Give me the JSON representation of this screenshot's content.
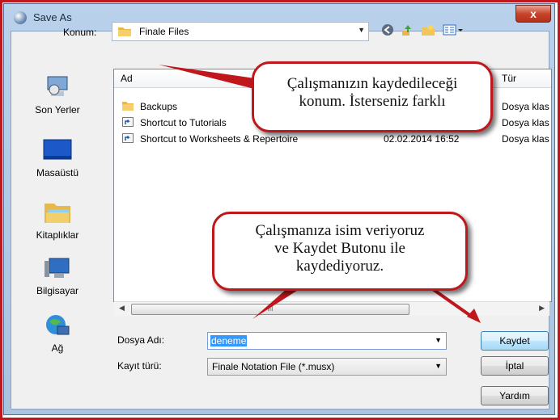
{
  "window": {
    "title": "Save As",
    "close_label": "x"
  },
  "location": {
    "label": "Konum:",
    "value": "Finale Files"
  },
  "toolbar": {
    "icons": [
      "back-icon",
      "up-folder-icon",
      "new-folder-icon",
      "view-menu-icon"
    ]
  },
  "places": [
    {
      "label": "Son Yerler",
      "icon": "recent-places-icon"
    },
    {
      "label": "Masaüstü",
      "icon": "desktop-icon"
    },
    {
      "label": "Kitaplıklar",
      "icon": "libraries-icon"
    },
    {
      "label": "Bilgisayar",
      "icon": "computer-icon"
    },
    {
      "label": "Ağ",
      "icon": "network-icon"
    }
  ],
  "list": {
    "columns": {
      "name": "Ad",
      "type": "Tür"
    },
    "rows": [
      {
        "name": "Backups",
        "date": "",
        "type": "Dosya klas",
        "icon": "folder-icon"
      },
      {
        "name": "Shortcut to Tutorials",
        "date": "",
        "type": "Dosya klas",
        "icon": "shortcut-icon"
      },
      {
        "name": "Shortcut to Worksheets & Repertoire",
        "date": "02.02.2014 16:52",
        "type": "Dosya klas",
        "icon": "shortcut-icon"
      }
    ],
    "scroll_thumb": "III"
  },
  "fields": {
    "filename_label": "Dosya Adı:",
    "filename_value": "deneme",
    "filetype_label": "Kayıt türü:",
    "filetype_value": "Finale Notation File (*.musx)"
  },
  "buttons": {
    "save": "Kaydet",
    "cancel": "İptal",
    "help": "Yardım"
  },
  "callouts": {
    "top_line1": "Çalışmanızın kaydedileceği",
    "top_line2": "konum. İsterseniz farklı",
    "mid_line1": "Çalışmanıza isim veriyoruz",
    "mid_line2": "ve Kaydet Butonu ile",
    "mid_line3": "kaydediyoruz."
  },
  "colors": {
    "annotation": "#c0171c",
    "selection": "#3399ff"
  }
}
